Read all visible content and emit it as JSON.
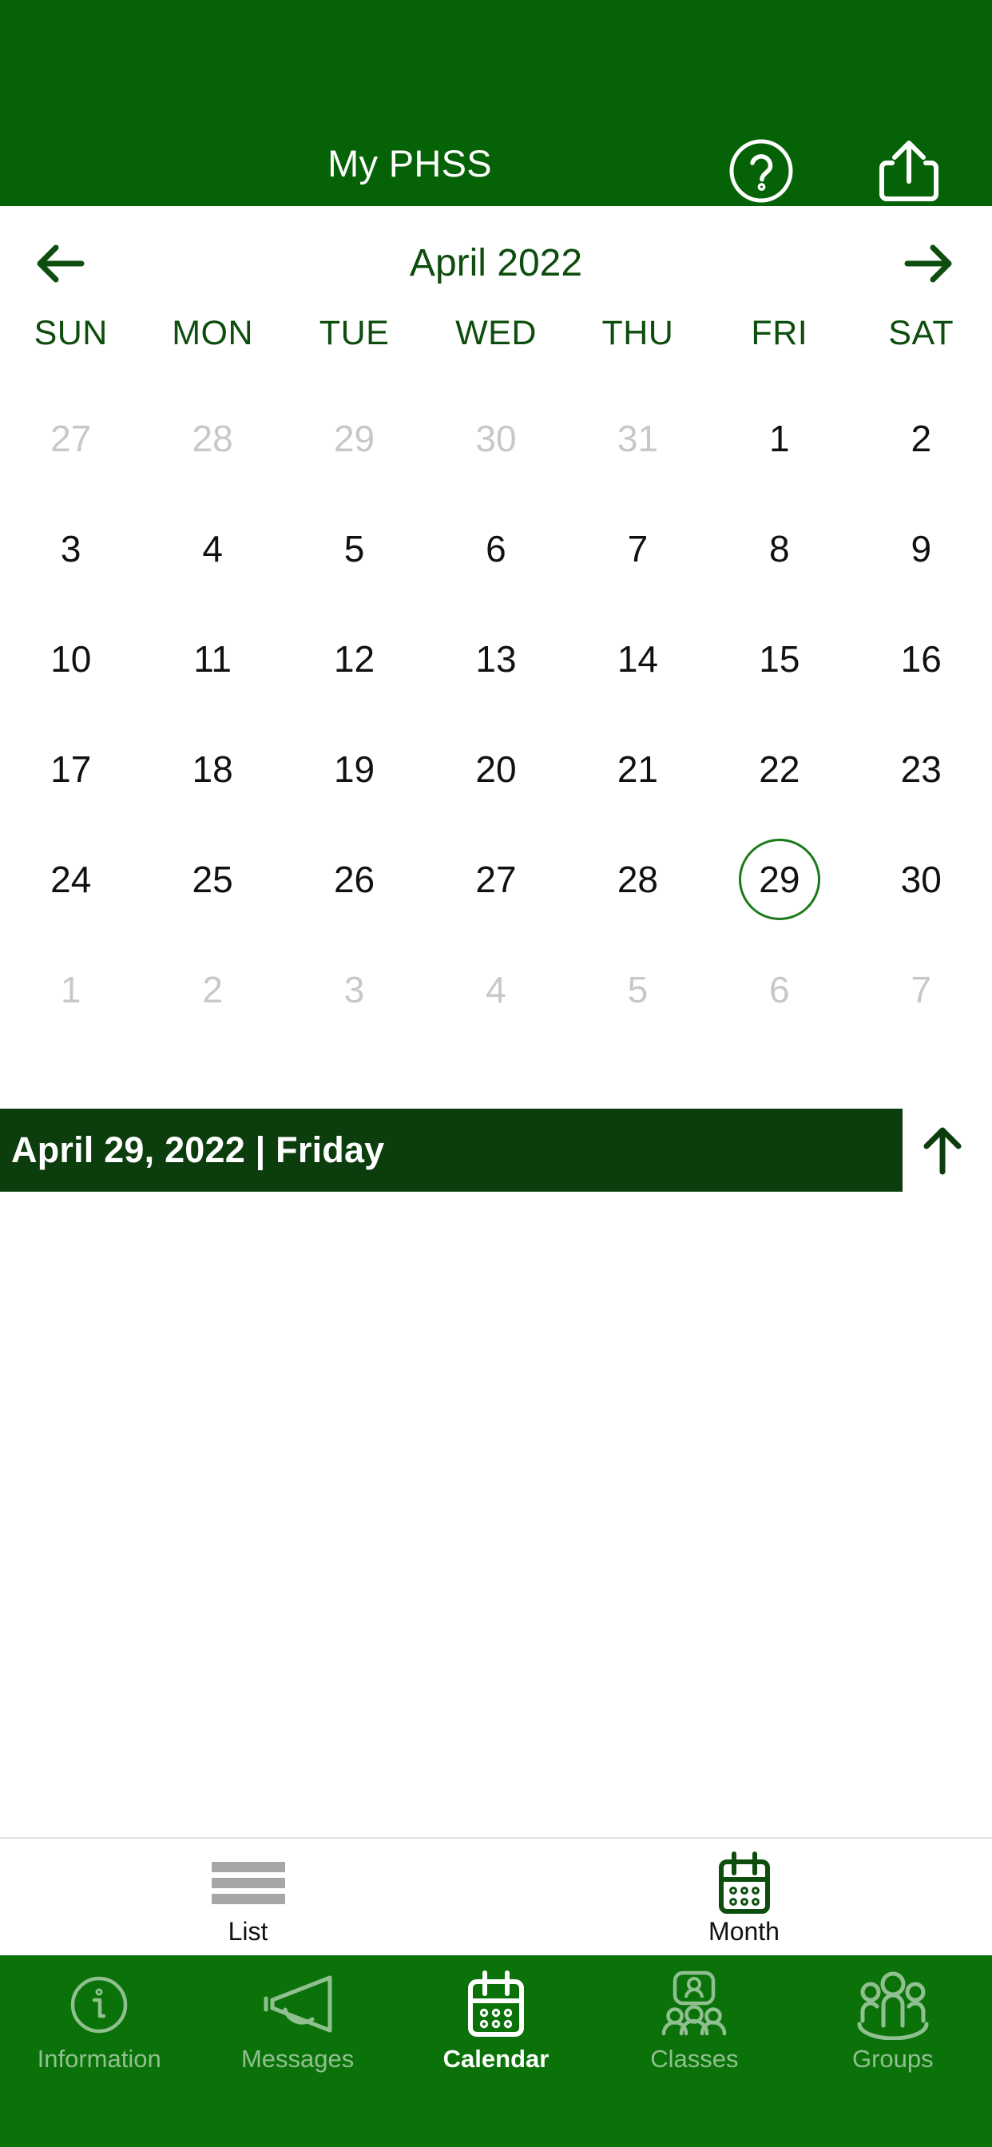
{
  "header": {
    "title": "My PHSS",
    "help_icon": "help-circle-icon",
    "share_icon": "share-upload-icon",
    "background_color": "#066206"
  },
  "month_nav": {
    "prev_label": "previous-month",
    "next_label": "next-month",
    "month_title": "April 2022",
    "accent_color": "#0d4d0d"
  },
  "weekdays": [
    "SUN",
    "MON",
    "TUE",
    "WED",
    "THU",
    "FRI",
    "SAT"
  ],
  "calendar": {
    "month": "April",
    "year": "2022",
    "selected_day": "29",
    "selected_circle_color": "#1a7a1a",
    "weeks": [
      [
        {
          "num": "27",
          "muted": true,
          "selected": false
        },
        {
          "num": "28",
          "muted": true,
          "selected": false
        },
        {
          "num": "29",
          "muted": true,
          "selected": false
        },
        {
          "num": "30",
          "muted": true,
          "selected": false
        },
        {
          "num": "31",
          "muted": true,
          "selected": false
        },
        {
          "num": "1",
          "muted": false,
          "selected": false
        },
        {
          "num": "2",
          "muted": false,
          "selected": false
        }
      ],
      [
        {
          "num": "3",
          "muted": false,
          "selected": false
        },
        {
          "num": "4",
          "muted": false,
          "selected": false
        },
        {
          "num": "5",
          "muted": false,
          "selected": false
        },
        {
          "num": "6",
          "muted": false,
          "selected": false
        },
        {
          "num": "7",
          "muted": false,
          "selected": false
        },
        {
          "num": "8",
          "muted": false,
          "selected": false
        },
        {
          "num": "9",
          "muted": false,
          "selected": false
        }
      ],
      [
        {
          "num": "10",
          "muted": false,
          "selected": false
        },
        {
          "num": "11",
          "muted": false,
          "selected": false
        },
        {
          "num": "12",
          "muted": false,
          "selected": false
        },
        {
          "num": "13",
          "muted": false,
          "selected": false
        },
        {
          "num": "14",
          "muted": false,
          "selected": false
        },
        {
          "num": "15",
          "muted": false,
          "selected": false
        },
        {
          "num": "16",
          "muted": false,
          "selected": false
        }
      ],
      [
        {
          "num": "17",
          "muted": false,
          "selected": false
        },
        {
          "num": "18",
          "muted": false,
          "selected": false
        },
        {
          "num": "19",
          "muted": false,
          "selected": false
        },
        {
          "num": "20",
          "muted": false,
          "selected": false
        },
        {
          "num": "21",
          "muted": false,
          "selected": false
        },
        {
          "num": "22",
          "muted": false,
          "selected": false
        },
        {
          "num": "23",
          "muted": false,
          "selected": false
        }
      ],
      [
        {
          "num": "24",
          "muted": false,
          "selected": false
        },
        {
          "num": "25",
          "muted": false,
          "selected": false
        },
        {
          "num": "26",
          "muted": false,
          "selected": false
        },
        {
          "num": "27",
          "muted": false,
          "selected": false
        },
        {
          "num": "28",
          "muted": false,
          "selected": false
        },
        {
          "num": "29",
          "muted": false,
          "selected": true
        },
        {
          "num": "30",
          "muted": false,
          "selected": false
        }
      ],
      [
        {
          "num": "1",
          "muted": true,
          "selected": false
        },
        {
          "num": "2",
          "muted": true,
          "selected": false
        },
        {
          "num": "3",
          "muted": true,
          "selected": false
        },
        {
          "num": "4",
          "muted": true,
          "selected": false
        },
        {
          "num": "5",
          "muted": true,
          "selected": false
        },
        {
          "num": "6",
          "muted": true,
          "selected": false
        },
        {
          "num": "7",
          "muted": true,
          "selected": false
        }
      ]
    ]
  },
  "date_banner": {
    "text": "April 29, 2022 | Friday",
    "background_color": "#0c3d0c",
    "collapse_icon": "arrow-up-icon"
  },
  "view_tabs": [
    {
      "label": "List",
      "icon": "list-lines-icon",
      "active": false
    },
    {
      "label": "Month",
      "icon": "calendar-month-icon",
      "active": true
    }
  ],
  "bottom_nav": {
    "background_color": "#0a7209",
    "items": [
      {
        "label": "Information",
        "icon": "info-circle-icon",
        "active": false
      },
      {
        "label": "Messages",
        "icon": "megaphone-icon",
        "active": false
      },
      {
        "label": "Calendar",
        "icon": "calendar-icon",
        "active": true
      },
      {
        "label": "Classes",
        "icon": "person-group-icon",
        "active": false
      },
      {
        "label": "Groups",
        "icon": "people-group-icon",
        "active": false
      }
    ]
  }
}
